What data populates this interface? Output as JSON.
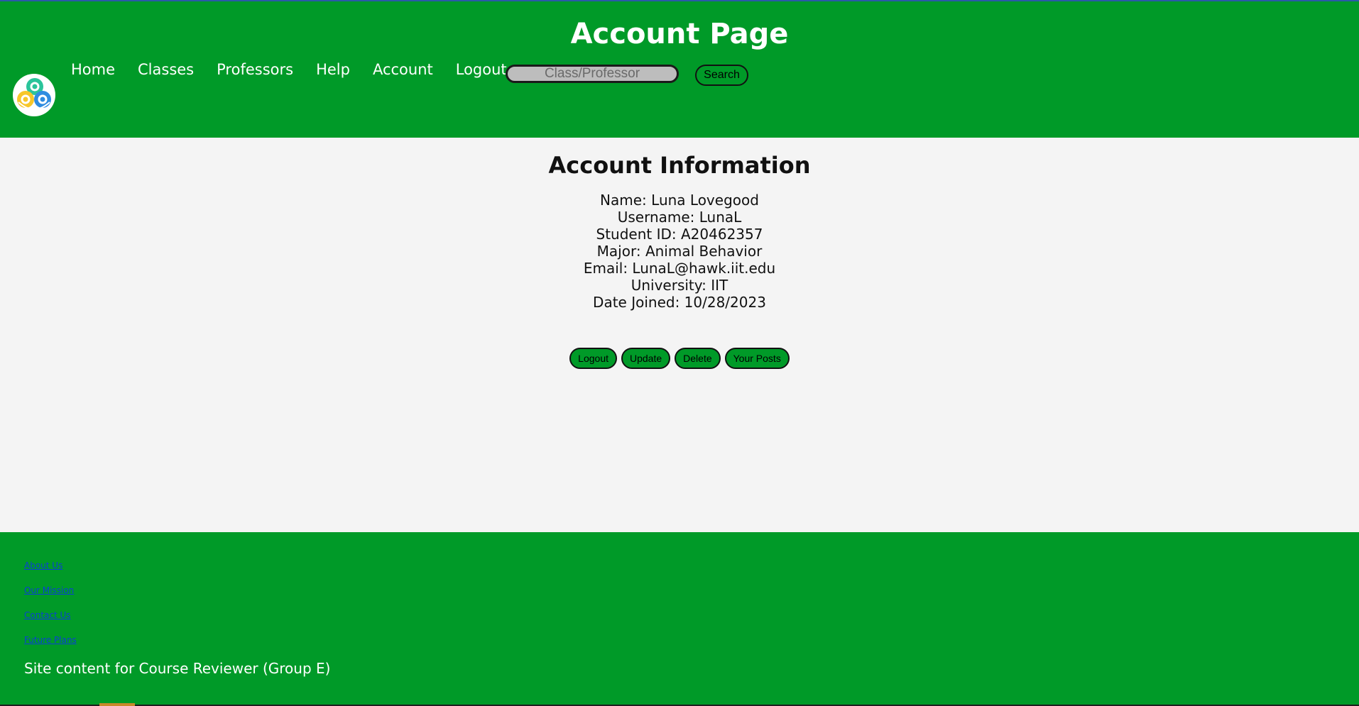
{
  "header": {
    "title": "Account Page",
    "logo_icon": "swirl-logo-icon",
    "nav": [
      {
        "label": "Home"
      },
      {
        "label": "Classes"
      },
      {
        "label": "Professors"
      },
      {
        "label": "Help"
      },
      {
        "label": "Account"
      },
      {
        "label": "Logout"
      }
    ],
    "search": {
      "placeholder": "Class/Professor",
      "value": "",
      "button_label": "Search"
    }
  },
  "account": {
    "heading": "Account Information",
    "fields": [
      "Name: Luna Lovegood",
      "Username: LunaL",
      "Student ID: A20462357",
      "Major: Animal Behavior",
      "Email: LunaL@hawk.iit.edu",
      "University: IIT",
      "Date Joined: 10/28/2023"
    ],
    "buttons": [
      {
        "label": "Logout"
      },
      {
        "label": "Update"
      },
      {
        "label": "Delete"
      },
      {
        "label": "Your Posts"
      }
    ]
  },
  "footer": {
    "links": [
      {
        "label": "About Us"
      },
      {
        "label": "Our Mission"
      },
      {
        "label": "Contact Us"
      },
      {
        "label": "Future Plans"
      }
    ],
    "credit": "Site content for Course Reviewer (Group E)"
  },
  "colors": {
    "brand_green": "#009a28",
    "background": "#f4f4f4",
    "footer_link": "#0a3fd6"
  }
}
